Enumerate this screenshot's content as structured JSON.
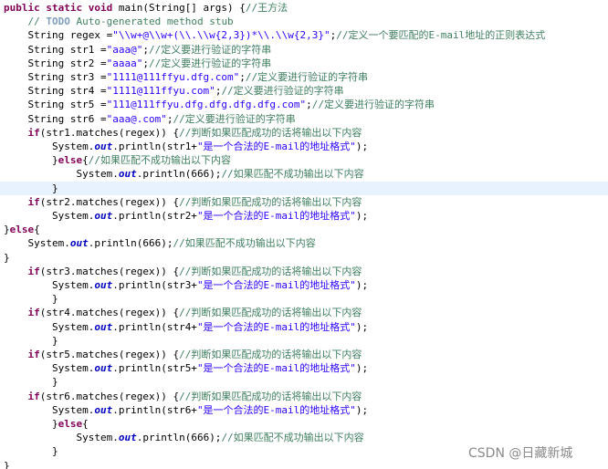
{
  "editor": {
    "lines": [
      [
        [
          "kw",
          "public static void"
        ],
        [
          "txt",
          " main(String[] args) {"
        ],
        [
          "cm",
          "//王方法"
        ]
      ],
      [
        [
          "txt",
          "    "
        ],
        [
          "cm",
          "// "
        ],
        [
          "todo",
          "TODO"
        ],
        [
          "cm",
          " Auto-generated method stub"
        ]
      ],
      [
        [
          "txt",
          "    String regex ="
        ],
        [
          "str",
          "\"\\\\w+@\\\\w+(\\\\.\\\\w{2,3})*\\\\.\\\\w{2,3}\""
        ],
        [
          "txt",
          ";"
        ],
        [
          "cm",
          "//定义一个要匹配的E-mail地址的正则表达式"
        ]
      ],
      [
        [
          "txt",
          "    String str1 ="
        ],
        [
          "str",
          "\"aaa@\""
        ],
        [
          "txt",
          ";"
        ],
        [
          "cm",
          "//定义要进行验证的字符串"
        ]
      ],
      [
        [
          "txt",
          "    String str2 ="
        ],
        [
          "str",
          "\"aaaa\""
        ],
        [
          "txt",
          ";"
        ],
        [
          "cm",
          "//定义要进行验证的字符串"
        ]
      ],
      [
        [
          "txt",
          "    String str3 ="
        ],
        [
          "str",
          "\"1111@111ffyu.dfg.com\""
        ],
        [
          "txt",
          ";"
        ],
        [
          "cm",
          "//定义要进行验证的字符串"
        ]
      ],
      [
        [
          "txt",
          "    String str4 ="
        ],
        [
          "str",
          "\"1111@111ffyu.com\""
        ],
        [
          "txt",
          ";"
        ],
        [
          "cm",
          "//定义要进行验证的字符串"
        ]
      ],
      [
        [
          "txt",
          "    String str5 ="
        ],
        [
          "str",
          "\"111@111ffyu.dfg.dfg.dfg.dfg.com\""
        ],
        [
          "txt",
          ";"
        ],
        [
          "cm",
          "//定义要进行验证的字符串"
        ]
      ],
      [
        [
          "txt",
          "    String str6 ="
        ],
        [
          "str",
          "\"aaa@.com\""
        ],
        [
          "txt",
          ";"
        ],
        [
          "cm",
          "//定义要进行验证的字符串"
        ]
      ],
      [
        [
          "txt",
          "    "
        ],
        [
          "kw",
          "if"
        ],
        [
          "txt",
          "(str1.matches(regex)) {"
        ],
        [
          "cm",
          "//判断如果匹配成功的话将输出以下内容"
        ]
      ],
      [
        [
          "txt",
          "        System."
        ],
        [
          "fld",
          "out"
        ],
        [
          "txt",
          ".println(str1+"
        ],
        [
          "str",
          "\"是一个合法的E-mail的地址格式\""
        ],
        [
          "txt",
          ");"
        ]
      ],
      [
        [
          "txt",
          "        }"
        ],
        [
          "kw",
          "else"
        ],
        [
          "txt",
          "{"
        ],
        [
          "cm",
          "//如果匹配不成功输出以下内容"
        ]
      ],
      [
        [
          "txt",
          "            System."
        ],
        [
          "fld",
          "out"
        ],
        [
          "txt",
          ".println(666);"
        ],
        [
          "cm",
          "//如果匹配不成功输出以下内容"
        ]
      ],
      [
        [
          "txt",
          "        }"
        ]
      ],
      [
        [
          "txt",
          "    "
        ],
        [
          "kw",
          "if"
        ],
        [
          "txt",
          "(str2.matches(regex)) {"
        ],
        [
          "cm",
          "//判断如果匹配成功的话将输出以下内容"
        ]
      ],
      [
        [
          "txt",
          "        System."
        ],
        [
          "fld",
          "out"
        ],
        [
          "txt",
          ".println(str2+"
        ],
        [
          "str",
          "\"是一个合法的E-mail的地址格式\""
        ],
        [
          "txt",
          ");"
        ]
      ],
      [
        [
          "txt",
          "}"
        ],
        [
          "kw",
          "else"
        ],
        [
          "txt",
          "{"
        ]
      ],
      [
        [
          "txt",
          "    System."
        ],
        [
          "fld",
          "out"
        ],
        [
          "txt",
          ".println(666);"
        ],
        [
          "cm",
          "//如果匹配不成功输出以下内容"
        ]
      ],
      [
        [
          "txt",
          "}"
        ]
      ],
      [
        [
          "txt",
          "    "
        ],
        [
          "kw",
          "if"
        ],
        [
          "txt",
          "(str3.matches(regex)) {"
        ],
        [
          "cm",
          "//判断如果匹配成功的话将输出以下内容"
        ]
      ],
      [
        [
          "txt",
          "        System."
        ],
        [
          "fld",
          "out"
        ],
        [
          "txt",
          ".println(str3+"
        ],
        [
          "str",
          "\"是一个合法的E-mail的地址格式\""
        ],
        [
          "txt",
          ");"
        ]
      ],
      [
        [
          "txt",
          "        }"
        ]
      ],
      [
        [
          "txt",
          "    "
        ],
        [
          "kw",
          "if"
        ],
        [
          "txt",
          "(str4.matches(regex)) {"
        ],
        [
          "cm",
          "//判断如果匹配成功的话将输出以下内容"
        ]
      ],
      [
        [
          "txt",
          "        System."
        ],
        [
          "fld",
          "out"
        ],
        [
          "txt",
          ".println(str4+"
        ],
        [
          "str",
          "\"是一个合法的E-mail的地址格式\""
        ],
        [
          "txt",
          ");"
        ]
      ],
      [
        [
          "txt",
          "        }"
        ]
      ],
      [
        [
          "txt",
          "    "
        ],
        [
          "kw",
          "if"
        ],
        [
          "txt",
          "(str5.matches(regex)) {"
        ],
        [
          "cm",
          "//判断如果匹配成功的话将输出以下内容"
        ]
      ],
      [
        [
          "txt",
          "        System."
        ],
        [
          "fld",
          "out"
        ],
        [
          "txt",
          ".println(str5+"
        ],
        [
          "str",
          "\"是一个合法的E-mail的地址格式\""
        ],
        [
          "txt",
          ");"
        ]
      ],
      [
        [
          "txt",
          "        }"
        ]
      ],
      [
        [
          "txt",
          "    "
        ],
        [
          "kw",
          "if"
        ],
        [
          "txt",
          "(str6.matches(regex)) {"
        ],
        [
          "cm",
          "//判断如果匹配成功的话将输出以下内容"
        ]
      ],
      [
        [
          "txt",
          "        System."
        ],
        [
          "fld",
          "out"
        ],
        [
          "txt",
          ".println(str6+"
        ],
        [
          "str",
          "\"是一个合法的E-mail的地址格式\""
        ],
        [
          "txt",
          ");"
        ]
      ],
      [
        [
          "txt",
          "        }"
        ],
        [
          "kw",
          "else"
        ],
        [
          "txt",
          "{"
        ]
      ],
      [
        [
          "txt",
          "            System."
        ],
        [
          "fld",
          "out"
        ],
        [
          "txt",
          ".println(666);"
        ],
        [
          "cm",
          "//如果匹配不成功输出以下内容"
        ]
      ],
      [
        [
          "txt",
          "        }"
        ]
      ],
      [
        [
          "txt",
          "}"
        ]
      ]
    ],
    "highlighted_line": 13,
    "colors": {
      "keyword": "#7f0055",
      "comment": "#3f7f5f",
      "string": "#2a00ff",
      "field": "#0000c0",
      "todo": "#7f9fbf",
      "current_line": "#e8f2fe"
    }
  },
  "watermark": {
    "text": "CSDN @日藏新城"
  }
}
